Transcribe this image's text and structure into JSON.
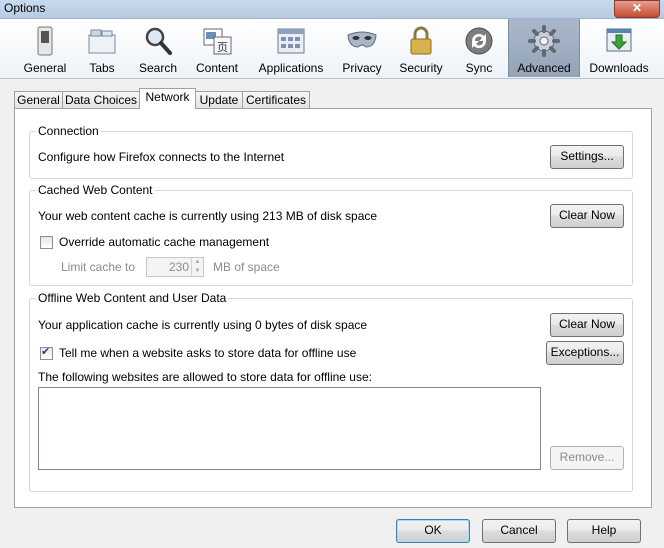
{
  "window": {
    "title": "Options",
    "close_glyph": "✕"
  },
  "toolbar": {
    "items": [
      {
        "label": "General",
        "icon": "switch-icon"
      },
      {
        "label": "Tabs",
        "icon": "tabs-icon"
      },
      {
        "label": "Search",
        "icon": "magnifier-icon"
      },
      {
        "label": "Content",
        "icon": "content-icon"
      },
      {
        "label": "Applications",
        "icon": "applications-icon"
      },
      {
        "label": "Privacy",
        "icon": "mask-icon"
      },
      {
        "label": "Security",
        "icon": "padlock-icon"
      },
      {
        "label": "Sync",
        "icon": "sync-icon"
      },
      {
        "label": "Advanced",
        "icon": "gear-icon",
        "selected": true
      },
      {
        "label": "Downloads",
        "icon": "download-icon"
      }
    ]
  },
  "tabs": [
    {
      "label": "General"
    },
    {
      "label": "Data Choices"
    },
    {
      "label": "Network",
      "active": true
    },
    {
      "label": "Update"
    },
    {
      "label": "Certificates"
    }
  ],
  "connection": {
    "title": "Connection",
    "description": "Configure how Firefox connects to the Internet",
    "settings_button": "Settings..."
  },
  "cache": {
    "title": "Cached Web Content",
    "usage_text": "Your web content cache is currently using 213 MB of disk space",
    "clear_button": "Clear Now",
    "override_label": "Override automatic cache management",
    "override_checked": false,
    "limit_label": "Limit cache to",
    "limit_value": "230",
    "limit_unit": "MB of space"
  },
  "offline": {
    "title": "Offline Web Content and User Data",
    "usage_text": "Your application cache is currently using 0 bytes of disk space",
    "clear_button": "Clear Now",
    "tell_label": "Tell me when a website asks to store data for offline use",
    "tell_checked": true,
    "exceptions_button": "Exceptions...",
    "allowed_label": "The following websites are allowed to store data for offline use:",
    "remove_button": "Remove..."
  },
  "footer": {
    "ok": "OK",
    "cancel": "Cancel",
    "help": "Help"
  }
}
